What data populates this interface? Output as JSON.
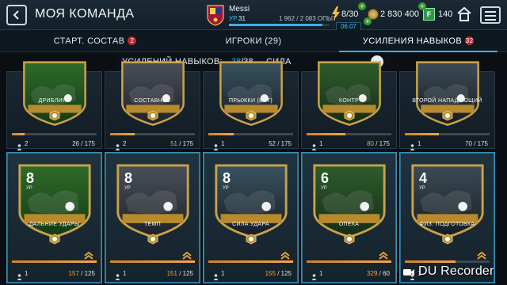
{
  "header": {
    "title": "МОЯ КОМАНДА",
    "player_name": "Messi",
    "level_label": "УР",
    "level_value": "31",
    "xp_text": "1 962 / 2 083 ОПЫТ",
    "xp_progress": 0.94,
    "energy": "8/30",
    "timer": "06:07",
    "coins": "2 830 400",
    "fp_badge": "F",
    "fifa_points": "140",
    "colors": {
      "accent": "#3ab0e6",
      "bar_bg": "#1b2a36"
    }
  },
  "tabs": [
    {
      "label": "СТАРТ. СОСТАВ",
      "badge": "2",
      "active": false
    },
    {
      "label": "ИГРОКИ (29)",
      "badge": "",
      "active": false
    },
    {
      "label": "УСИЛЕНИЯ НАВЫКОВ",
      "badge": "32",
      "active": true
    }
  ],
  "filter": {
    "label": "УСИЛЕНИЙ НАВЫКОВ:",
    "count_current": "38",
    "count_total": "/38",
    "category": "СИЛА"
  },
  "top_row": [
    {
      "label": "ДРИБЛИНГ",
      "count": "2",
      "xp_current": "26",
      "xp_total": "/ 175",
      "progress": 0.149
    },
    {
      "label": "СОСТАВНОЕ",
      "count": "2",
      "xp_current": "51",
      "xp_total": "/ 175",
      "progress": 0.291
    },
    {
      "label": "ПРЫЖКИ (ВРТ)",
      "count": "1",
      "xp_current": "52",
      "xp_total": "/ 175",
      "progress": 0.297
    },
    {
      "label": "КОНТР",
      "count": "1",
      "xp_current": "80",
      "xp_total": "/ 175",
      "progress": 0.457
    },
    {
      "label": "ВТОРОЙ НАПАДАЮЩИЙ",
      "count": "1",
      "xp_current": "70",
      "xp_total": "/ 175",
      "progress": 0.4
    }
  ],
  "bottom_row": [
    {
      "label": "ДАЛЬНИЕ УДАРЫ",
      "level": "8",
      "ur": "УР",
      "count": "1",
      "xp_current": "157",
      "xp_total": "/ 125",
      "progress": 1.0,
      "upgradable": true
    },
    {
      "label": "ТЕМП",
      "level": "8",
      "ur": "УР",
      "count": "1",
      "xp_current": "151",
      "xp_total": "/ 125",
      "progress": 1.0,
      "upgradable": true
    },
    {
      "label": "СИЛА УДАРА",
      "level": "8",
      "ur": "УР",
      "count": "1",
      "xp_current": "155",
      "xp_total": "/ 125",
      "progress": 1.0,
      "upgradable": true
    },
    {
      "label": "ОПЕКА",
      "level": "6",
      "ur": "УР",
      "count": "1",
      "xp_current": "329",
      "xp_total": "/ 60",
      "progress": 1.0,
      "upgradable": true
    },
    {
      "label": "ФИЗ. ПОДГОТОВКА",
      "level": "4",
      "ur": "УР",
      "count": "1",
      "xp_current": "",
      "xp_total": "",
      "progress": 0.6,
      "upgradable": true
    }
  ],
  "watermark": "DU Recorder"
}
